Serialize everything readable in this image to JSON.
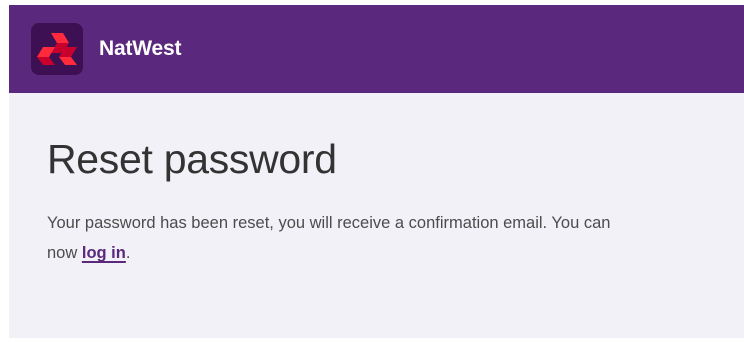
{
  "header": {
    "brand_name": "NatWest",
    "logo_icon": "natwest-cubes-logo",
    "background_color": "#5a287d",
    "logo_colors": [
      "#e60028",
      "#a5002a",
      "#ff3333"
    ]
  },
  "main": {
    "title": "Reset password",
    "message_before_link": "Your password has been reset, you will receive a confirmation email. You can now ",
    "link_label": "log in",
    "message_after_link": ".",
    "background_color": "#f2f1f8"
  }
}
